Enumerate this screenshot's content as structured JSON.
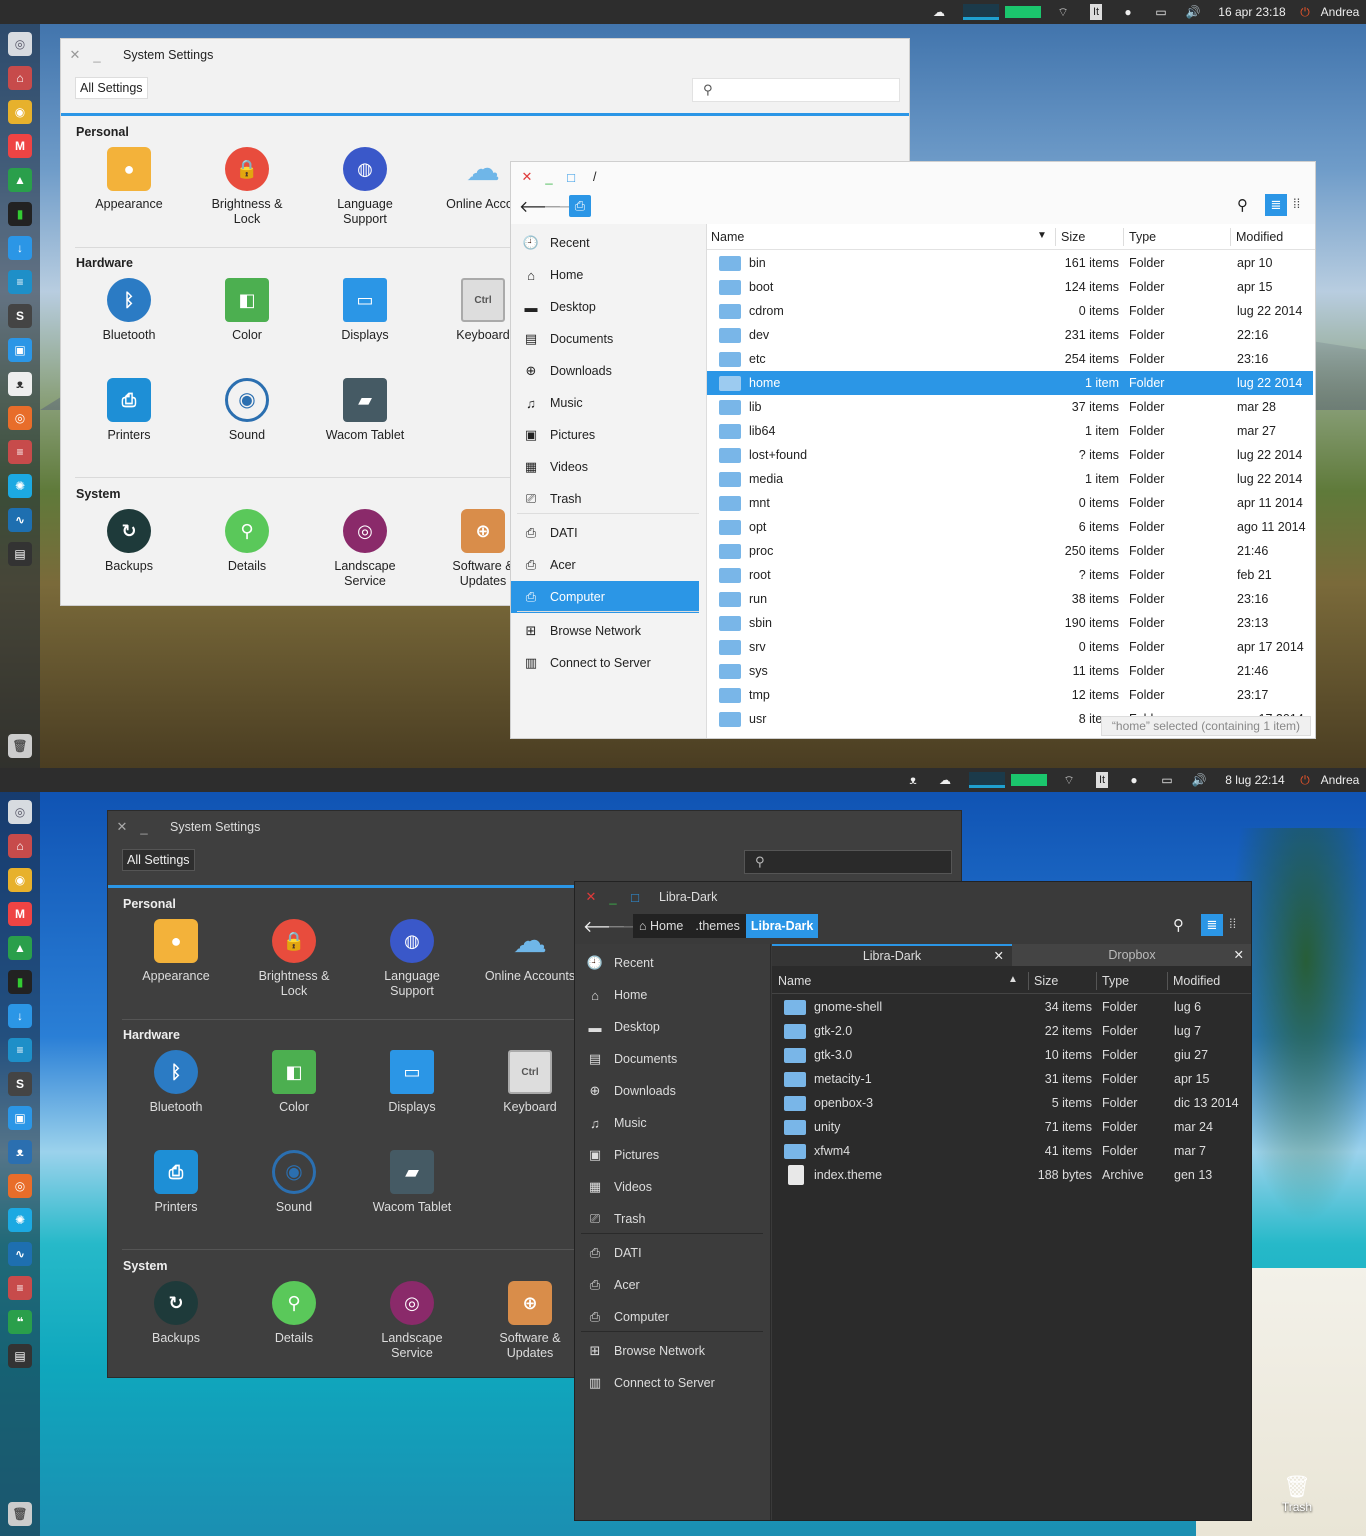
{
  "colors": {
    "accent": "#2b96e6",
    "panel": "#2d2d2d",
    "light_bg": "#f2f2f2",
    "dark_bg": "#3f3f3f",
    "folder": "#79b6e8"
  },
  "top": {
    "panel": {
      "date": "16 apr 23:18",
      "user": "Andrea",
      "kbd": "It"
    },
    "settings": {
      "title": "System Settings",
      "all_settings": "All Settings",
      "personal": "Personal",
      "hardware": "Hardware",
      "system": "System",
      "personal_items": [
        {
          "label": "Appearance",
          "icon": "appearance-icon"
        },
        {
          "label": "Brightness &\nLock",
          "icon": "lock-icon"
        },
        {
          "label": "Language\nSupport",
          "icon": "globe-icon"
        },
        {
          "label": "Online Accou",
          "icon": "cloud-icon"
        }
      ],
      "hardware_items": [
        {
          "label": "Bluetooth",
          "icon": "bluetooth-icon"
        },
        {
          "label": "Color",
          "icon": "color-icon"
        },
        {
          "label": "Displays",
          "icon": "display-icon"
        },
        {
          "label": "Keyboard",
          "icon": "keyboard-icon"
        },
        {
          "label": "Printers",
          "icon": "printer-icon"
        },
        {
          "label": "Sound",
          "icon": "sound-icon"
        },
        {
          "label": "Wacom Tablet",
          "icon": "tablet-icon"
        }
      ],
      "system_items": [
        {
          "label": "Backups",
          "icon": "backup-icon"
        },
        {
          "label": "Details",
          "icon": "details-icon"
        },
        {
          "label": "Landscape\nService",
          "icon": "landscape-icon"
        },
        {
          "label": "Software &\nUpdates",
          "icon": "software-icon"
        }
      ]
    },
    "files": {
      "path": "/",
      "sidebar": [
        "Recent",
        "Home",
        "Desktop",
        "Documents",
        "Downloads",
        "Music",
        "Pictures",
        "Videos",
        "Trash",
        "DATI",
        "Acer",
        "Computer",
        "Browse Network",
        "Connect to Server"
      ],
      "selected_sidebar": "Computer",
      "columns": {
        "name": "Name",
        "size": "Size",
        "type": "Type",
        "modified": "Modified"
      },
      "rows": [
        {
          "name": "bin",
          "size": "161 items",
          "type": "Folder",
          "modified": "apr 10"
        },
        {
          "name": "boot",
          "size": "124 items",
          "type": "Folder",
          "modified": "apr 15"
        },
        {
          "name": "cdrom",
          "size": "0 items",
          "type": "Folder",
          "modified": "lug 22 2014"
        },
        {
          "name": "dev",
          "size": "231 items",
          "type": "Folder",
          "modified": "22:16"
        },
        {
          "name": "etc",
          "size": "254 items",
          "type": "Folder",
          "modified": "23:16"
        },
        {
          "name": "home",
          "size": "1 item",
          "type": "Folder",
          "modified": "lug 22 2014"
        },
        {
          "name": "lib",
          "size": "37 items",
          "type": "Folder",
          "modified": "mar 28"
        },
        {
          "name": "lib64",
          "size": "1 item",
          "type": "Folder",
          "modified": "mar 27"
        },
        {
          "name": "lost+found",
          "size": "? items",
          "type": "Folder",
          "modified": "lug 22 2014"
        },
        {
          "name": "media",
          "size": "1 item",
          "type": "Folder",
          "modified": "lug 22 2014"
        },
        {
          "name": "mnt",
          "size": "0 items",
          "type": "Folder",
          "modified": "apr 11 2014"
        },
        {
          "name": "opt",
          "size": "6 items",
          "type": "Folder",
          "modified": "ago 11 2014"
        },
        {
          "name": "proc",
          "size": "250 items",
          "type": "Folder",
          "modified": "21:46"
        },
        {
          "name": "root",
          "size": "? items",
          "type": "Folder",
          "modified": "feb 21"
        },
        {
          "name": "run",
          "size": "38 items",
          "type": "Folder",
          "modified": "23:16"
        },
        {
          "name": "sbin",
          "size": "190 items",
          "type": "Folder",
          "modified": "23:13"
        },
        {
          "name": "srv",
          "size": "0 items",
          "type": "Folder",
          "modified": "apr 17 2014"
        },
        {
          "name": "sys",
          "size": "11 items",
          "type": "Folder",
          "modified": "21:46"
        },
        {
          "name": "tmp",
          "size": "12 items",
          "type": "Folder",
          "modified": "23:17"
        },
        {
          "name": "usr",
          "size": "8 items",
          "type": "Folder",
          "modified": "apr 17 2014"
        }
      ],
      "selected_row": "home",
      "status": "“home” selected  (containing 1 item)"
    }
  },
  "bottom": {
    "panel": {
      "date": "8 lug 22:14",
      "user": "Andrea",
      "kbd": "It"
    },
    "settings": {
      "title": "System Settings",
      "all_settings": "All Settings",
      "personal": "Personal",
      "hardware": "Hardware",
      "system": "System",
      "personal_items": [
        {
          "label": "Appearance",
          "icon": "appearance-icon"
        },
        {
          "label": "Brightness &\nLock",
          "icon": "lock-icon"
        },
        {
          "label": "Language\nSupport",
          "icon": "globe-icon"
        },
        {
          "label": "Online Accounts",
          "icon": "cloud-icon"
        }
      ],
      "hardware_items": [
        {
          "label": "Bluetooth",
          "icon": "bluetooth-icon"
        },
        {
          "label": "Color",
          "icon": "color-icon"
        },
        {
          "label": "Displays",
          "icon": "display-icon"
        },
        {
          "label": "Keyboard",
          "icon": "keyboard-icon"
        },
        {
          "label": "Printers",
          "icon": "printer-icon"
        },
        {
          "label": "Sound",
          "icon": "sound-icon"
        },
        {
          "label": "Wacom Tablet",
          "icon": "tablet-icon"
        }
      ],
      "system_items": [
        {
          "label": "Backups",
          "icon": "backup-icon"
        },
        {
          "label": "Details",
          "icon": "details-icon"
        },
        {
          "label": "Landscape\nService",
          "icon": "landscape-icon"
        },
        {
          "label": "Software &\nUpdates",
          "icon": "software-icon"
        }
      ]
    },
    "files": {
      "title": "Libra-Dark",
      "breadcrumb": [
        "Home",
        ".themes",
        "Libra-Dark"
      ],
      "tabs": [
        "Libra-Dark",
        "Dropbox"
      ],
      "sidebar": [
        "Recent",
        "Home",
        "Desktop",
        "Documents",
        "Downloads",
        "Music",
        "Pictures",
        "Videos",
        "Trash",
        "DATI",
        "Acer",
        "Computer",
        "Browse Network",
        "Connect to Server"
      ],
      "columns": {
        "name": "Name",
        "size": "Size",
        "type": "Type",
        "modified": "Modified"
      },
      "rows": [
        {
          "name": "gnome-shell",
          "size": "34 items",
          "type": "Folder",
          "modified": "lug 6"
        },
        {
          "name": "gtk-2.0",
          "size": "22 items",
          "type": "Folder",
          "modified": "lug 7"
        },
        {
          "name": "gtk-3.0",
          "size": "10 items",
          "type": "Folder",
          "modified": "giu 27"
        },
        {
          "name": "metacity-1",
          "size": "31 items",
          "type": "Folder",
          "modified": "apr 15"
        },
        {
          "name": "openbox-3",
          "size": "5 items",
          "type": "Folder",
          "modified": "dic 13 2014"
        },
        {
          "name": "unity",
          "size": "71 items",
          "type": "Folder",
          "modified": "mar 24"
        },
        {
          "name": "xfwm4",
          "size": "41 items",
          "type": "Folder",
          "modified": "mar 7"
        },
        {
          "name": "index.theme",
          "size": "188 bytes",
          "type": "Archive",
          "modified": "gen 13"
        }
      ]
    },
    "trash_label": "Trash"
  }
}
